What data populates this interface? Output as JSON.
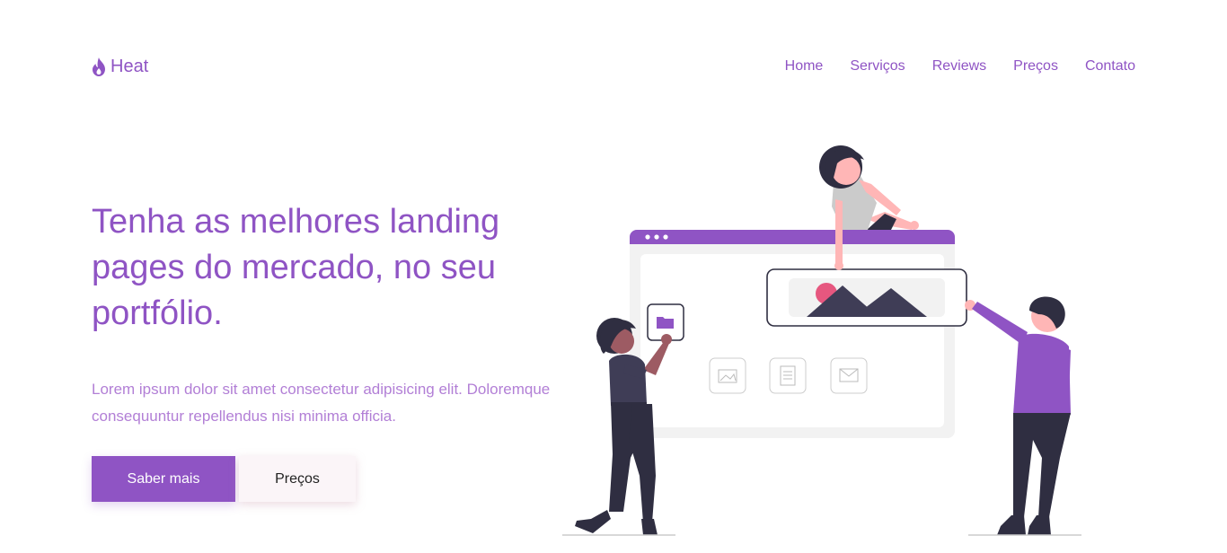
{
  "brand": {
    "name": "Heat",
    "icon": "flame-icon"
  },
  "nav": {
    "items": [
      {
        "label": "Home"
      },
      {
        "label": "Serviços"
      },
      {
        "label": "Reviews"
      },
      {
        "label": "Preços"
      },
      {
        "label": "Contato"
      }
    ]
  },
  "hero": {
    "title": "Tenha as melhores landing pages do mercado, no seu portfólio.",
    "text": "Lorem ipsum dolor sit amet consectetur adipisicing elit. Doloremque consequuntur repellendus nisi minima officia.",
    "primary_button": "Saber mais",
    "secondary_button": "Preços"
  },
  "colors": {
    "accent": "#8f54c4",
    "text_soft": "#b27fd6",
    "figure_dark": "#2f2e41",
    "skin": "#ffb6b6",
    "pink": "#e6577f"
  }
}
